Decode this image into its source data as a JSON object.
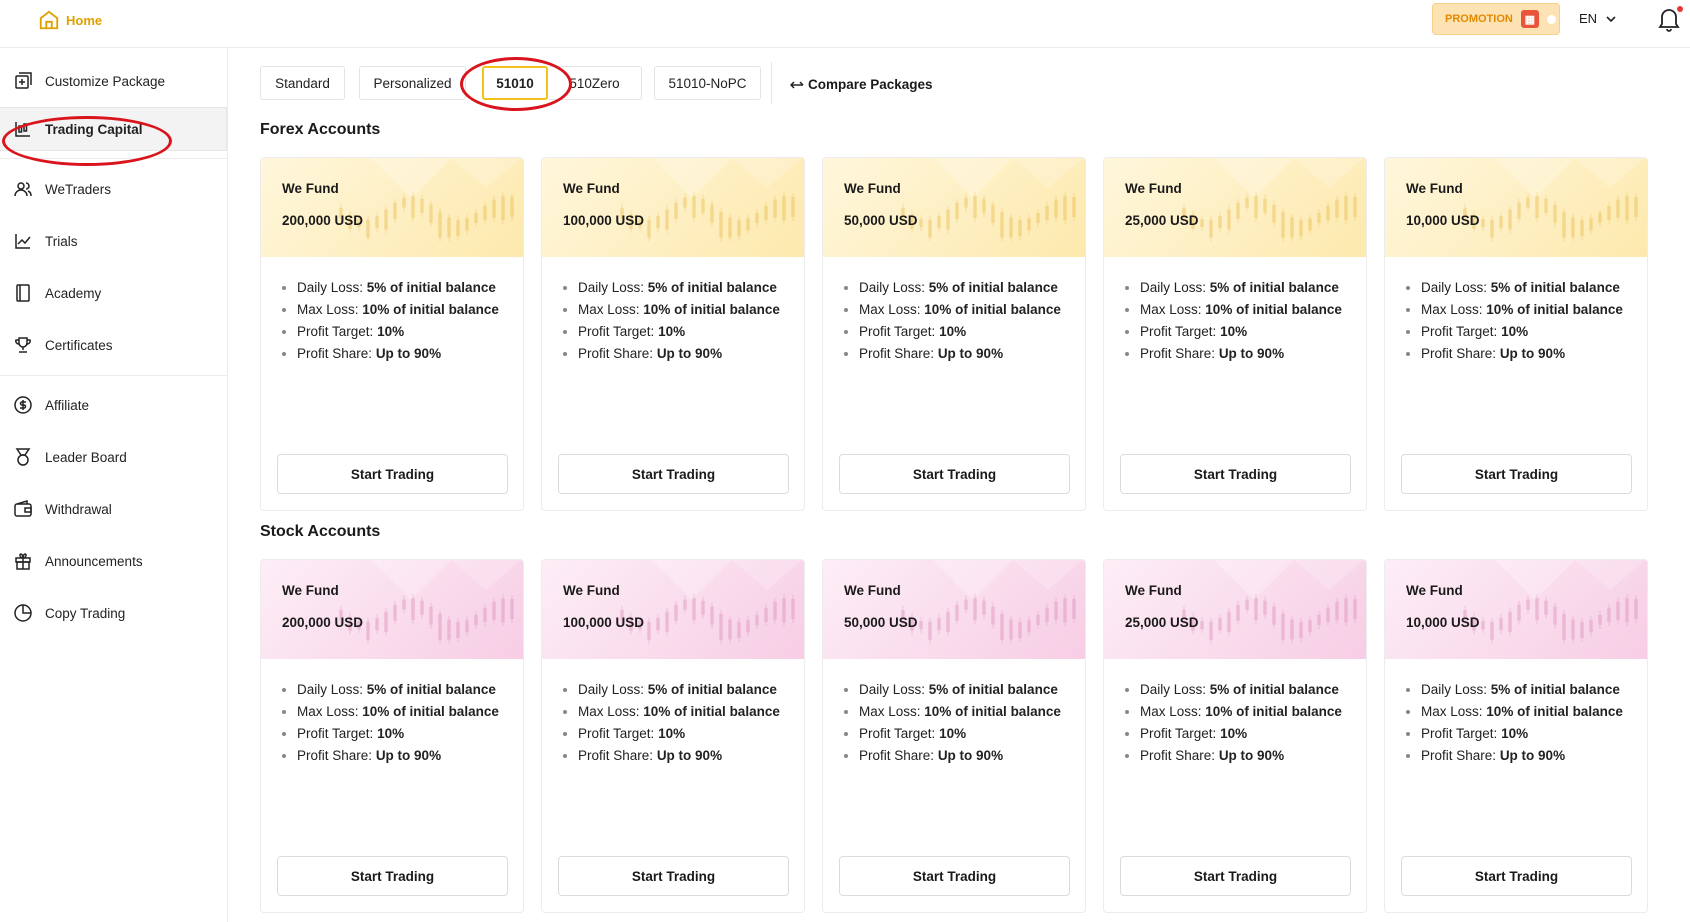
{
  "header": {
    "home_label": "Home",
    "promo_label": "PROMOTION",
    "lang_label": "EN"
  },
  "sidebar": {
    "items": [
      {
        "label": "Customize Package",
        "icon": "package-plus-icon"
      },
      {
        "label": "Trading Capital",
        "icon": "chart-candles-icon",
        "active": true
      },
      {
        "label": "WeTraders",
        "icon": "users-icon"
      },
      {
        "label": "Trials",
        "icon": "line-chart-icon"
      },
      {
        "label": "Academy",
        "icon": "book-icon"
      },
      {
        "label": "Certificates",
        "icon": "trophy-icon"
      },
      {
        "label": "Affiliate",
        "icon": "dollar-circle-icon"
      },
      {
        "label": "Leader Board",
        "icon": "medal-icon"
      },
      {
        "label": "Withdrawal",
        "icon": "wallet-icon"
      },
      {
        "label": "Announcements",
        "icon": "gift-icon"
      },
      {
        "label": "Copy Trading",
        "icon": "pie-clock-icon"
      }
    ]
  },
  "tabs": [
    {
      "label": "Standard"
    },
    {
      "label": "Personalized"
    },
    {
      "label": "51010",
      "active": true
    },
    {
      "label": "510Zero"
    },
    {
      "label": "51010-NoPC"
    }
  ],
  "compare_label": "Compare Packages",
  "sections": {
    "forex": {
      "title": "Forex Accounts",
      "theme": "#fde9ad",
      "cards": [
        {
          "we_fund": "We Fund",
          "amount": "200,000 USD"
        },
        {
          "we_fund": "We Fund",
          "amount": "100,000 USD"
        },
        {
          "we_fund": "We Fund",
          "amount": "50,000 USD"
        },
        {
          "we_fund": "We Fund",
          "amount": "25,000 USD"
        },
        {
          "we_fund": "We Fund",
          "amount": "10,000 USD"
        }
      ]
    },
    "stock": {
      "title": "Stock Accounts",
      "theme": "#f7cde5",
      "cards": [
        {
          "we_fund": "We Fund",
          "amount": "200,000 USD"
        },
        {
          "we_fund": "We Fund",
          "amount": "100,000 USD"
        },
        {
          "we_fund": "We Fund",
          "amount": "50,000 USD"
        },
        {
          "we_fund": "We Fund",
          "amount": "25,000 USD"
        },
        {
          "we_fund": "We Fund",
          "amount": "10,000 USD"
        }
      ]
    }
  },
  "rules": {
    "daily_loss_label": "Daily Loss:",
    "daily_loss_value": "5% of initial balance",
    "max_loss_label": "Max Loss:",
    "max_loss_value": "10% of initial balance",
    "profit_target_label": "Profit Target:",
    "profit_target_value": "10%",
    "profit_share_label": "Profit Share:",
    "profit_share_value": "Up to 90%"
  },
  "start_trading_label": "Start Trading",
  "annotation_color": "#d9141c"
}
